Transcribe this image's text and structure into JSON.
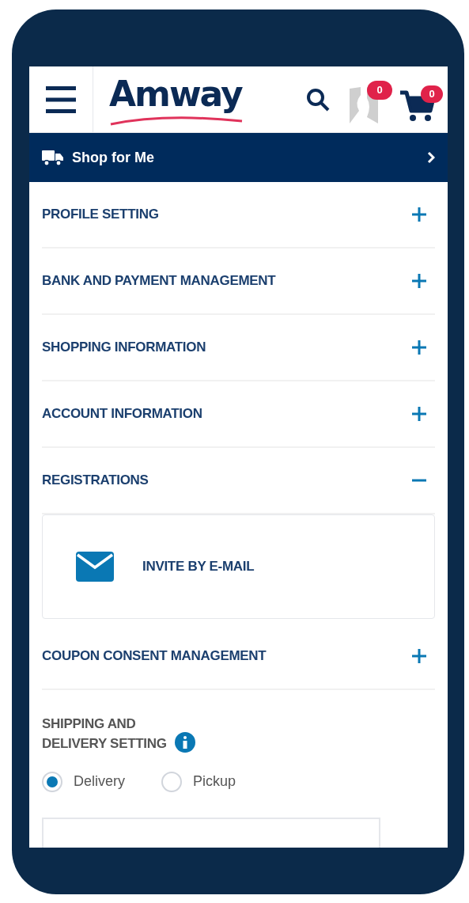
{
  "header": {
    "logo": "Amway",
    "wishlist_count": "0",
    "cart_count": "0"
  },
  "shop_bar": {
    "label": "Shop for **Me**"
  },
  "sections": [
    {
      "title": "PROFILE SETTING",
      "expanded": false
    },
    {
      "title": "BANK AND PAYMENT MANAGEMENT",
      "expanded": false
    },
    {
      "title": "SHOPPING INFORMATION",
      "expanded": false
    },
    {
      "title": "ACCOUNT INFORMATION",
      "expanded": false
    },
    {
      "title": "REGISTRATIONS",
      "expanded": true,
      "items": [
        {
          "label": "INVITE BY E-MAIL"
        }
      ]
    },
    {
      "title": "COUPON CONSENT MANAGEMENT",
      "expanded": false
    }
  ],
  "shipping": {
    "title_lines": [
      "SHIPPING AND",
      "DELIVERY SETTING"
    ],
    "options": [
      {
        "label": "Delivery",
        "selected": true
      },
      {
        "label": "Pickup",
        "selected": false
      }
    ]
  }
}
